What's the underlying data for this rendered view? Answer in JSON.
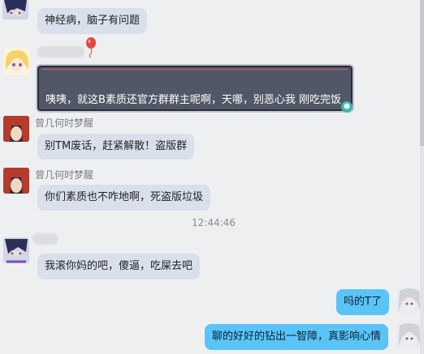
{
  "messages": [
    {
      "text": "神经病，脑子有问题",
      "avatar": "anime-girl-avatar"
    },
    {
      "text": "咦咦，就这B素质还官方群群主呢啊，天哪，别恶心我 刚吃完饭",
      "avatar": "blonde-anime-avatar"
    },
    {
      "sender": "曾几何时梦醒",
      "text": "别TM废话，赶紧解散！盗版群",
      "avatar": "red-hair-avatar"
    },
    {
      "sender": "曾几何时梦醒",
      "text": "你们素质也不咋地啊，死盗版垃圾",
      "avatar": "red-hair-avatar"
    },
    {
      "timestamp": "12:44:46"
    },
    {
      "text": "我滚你妈的吧，傻逼，吃屎去吧",
      "avatar": "anime-girl-avatar"
    },
    {
      "text": "吗的T了",
      "avatar": "miku-avatar",
      "side": "right"
    },
    {
      "text": "聊的好好的钻出一智障，真影响心情",
      "avatar": "miku-avatar",
      "side": "right"
    }
  ],
  "colors": {
    "background": "#eeeff1",
    "bubble_left": "#d9e0ec",
    "bubble_right": "#5ac4f7",
    "fancy_bubble": "#515766"
  }
}
